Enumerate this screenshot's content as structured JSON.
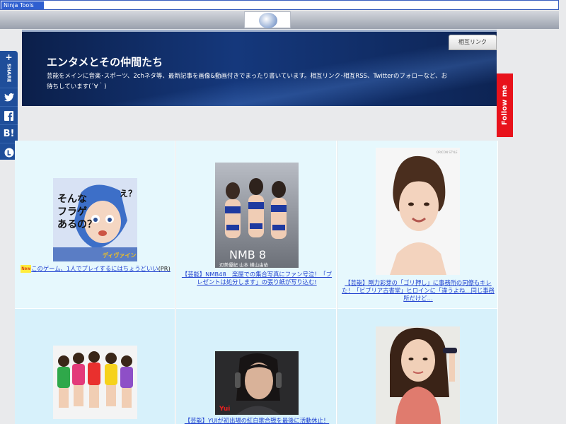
{
  "toolbar": {
    "label": "Ninja Tools"
  },
  "header": {
    "title": "エンタメとその仲間たち",
    "description": "芸能をメインに音楽･スポーツ、2chネタ等、最新記事を画像&動画付きでまったり書いています。相互リンク･相互RSS、Twitterのフォローなど、お待ちしています(´∀｀)",
    "link_button": "相互リンク"
  },
  "share": {
    "label": "SHARE",
    "plus": "+",
    "hatena": "B!"
  },
  "follow": {
    "label": "Follow me"
  },
  "posts": [
    {
      "badge": "New",
      "title": "このゲーム、1人でプレイするにはちょうどいい",
      "suffix": "(PR)",
      "image_text": "え？ そんなフラゲ あるの？",
      "image_logo": "ディヴァイン グリモワール"
    },
    {
      "title": "【芸能】NMB48　楽屋での集合写真にファン号泣！「プレゼントは処分します」の張り紙が写り込む!",
      "image_text": "NMB 8",
      "image_footer": "辺美優紀 山本 横山由依"
    },
    {
      "title": "【芸能】剛力彩芽の「ゴリ押し」に事務所の同僚もキレた！「ビブリア古書堂」ヒロインに「違うよね…同じ事務所だけど…",
      "image_small": "ORICON STYLE"
    },
    {
      "title": "",
      "image_text": ""
    },
    {
      "title": "【芸能】YUIが初出場の紅白歌合戦を最後に活動休止！",
      "image_logo": "Yui"
    },
    {
      "title": ""
    }
  ],
  "colors": {
    "header_dark": "#0b1f4a",
    "header_mid": "#15387c",
    "link_blue": "#1d3fcf",
    "follow_red": "#e8121b",
    "share_blue": "#1f4e9a"
  }
}
